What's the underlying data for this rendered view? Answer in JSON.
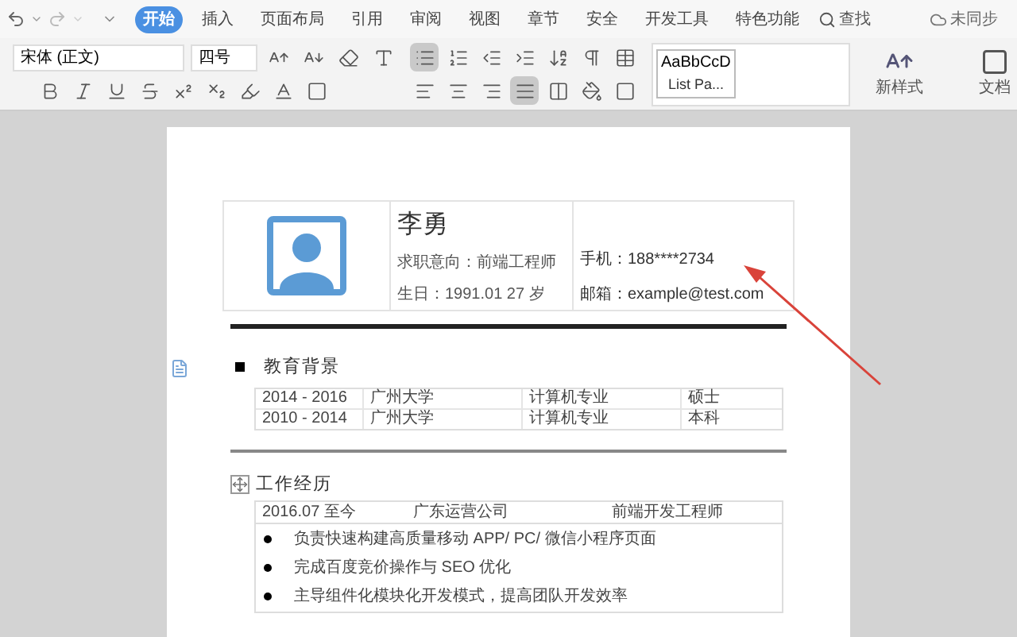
{
  "menu": {
    "tabs": [
      {
        "label": "开始",
        "selected": true
      },
      {
        "label": "插入",
        "selected": false
      },
      {
        "label": "页面布局",
        "selected": false
      },
      {
        "label": "引用",
        "selected": false
      },
      {
        "label": "审阅",
        "selected": false
      },
      {
        "label": "视图",
        "selected": false
      },
      {
        "label": "章节",
        "selected": false
      },
      {
        "label": "安全",
        "selected": false
      },
      {
        "label": "开发工具",
        "selected": false
      },
      {
        "label": "特色功能",
        "selected": false
      }
    ],
    "search": "查找",
    "sync": "未同步"
  },
  "toolbar": {
    "font": "宋体 (正文)",
    "size": "四号",
    "bullets_on": true,
    "justify_on": true,
    "style_preview": "AaBbCcD",
    "style_name": "List Pa...",
    "new_style": "新样式",
    "doc": "文档"
  },
  "resume": {
    "name": "李勇",
    "intent": "求职意向：前端工程师",
    "birth": "生日：1991.01 27 岁",
    "phone": "手机：188****2734",
    "email": "邮箱：example@test.com",
    "sections": [
      {
        "kind": "table",
        "title": "教育背景",
        "rows": [
          [
            "2014 - 2016",
            "广州大学",
            "计算机专业",
            "硕士"
          ],
          [
            "2010 - 2014",
            "广州大学",
            "计算机专业",
            "本科"
          ]
        ]
      },
      {
        "kind": "job",
        "title": "工作经历",
        "header": [
          "2016.07 至今",
          "广东运营公司",
          "前端开发工程师"
        ],
        "bullets": [
          "负责快速构建高质量移动 APP/ PC/ 微信小程序页面",
          "完成百度竞价操作与 SEO 优化",
          "主导组件化模块化开发模式，提高团队开发效率"
        ]
      }
    ]
  }
}
